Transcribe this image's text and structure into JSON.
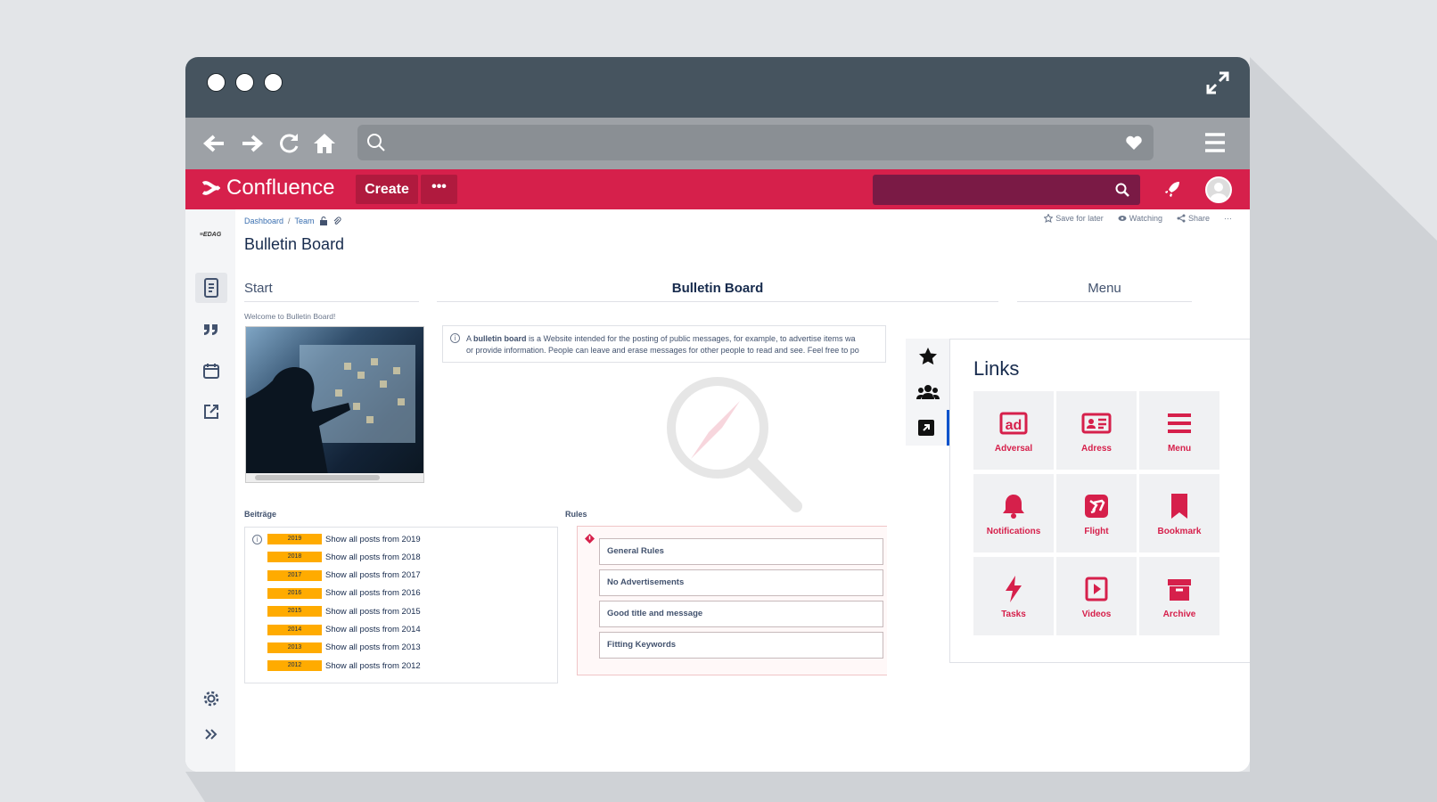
{
  "browser": {
    "nav": [
      "back-icon",
      "forward-icon",
      "reload-icon",
      "home-icon"
    ]
  },
  "confluence": {
    "logo_text": "Confluence",
    "create_label": "Create",
    "more_label": "•••",
    "accent": "#d6204b"
  },
  "sidebar": {
    "logo_text": "≡EDAG"
  },
  "page": {
    "breadcrumb": [
      "Dashboard",
      "Team"
    ],
    "breadcrumb_sep": "/",
    "title": "Bulletin Board",
    "actions": {
      "save": "Save for later",
      "watch": "Watching",
      "share": "Share",
      "more": "···"
    }
  },
  "columns": {
    "start": "Start",
    "center": "Bulletin Board",
    "menu": "Menu"
  },
  "welcome_text": "Welcome to Bulletin Board!",
  "info": {
    "bold": "bulletin board",
    "prefix": "A",
    "line1": " is a Website intended for the posting of public messages, for example, to advertise items wa",
    "line2": "or provide information. People can leave and erase messages for other people to read and see. Feel free to po"
  },
  "beitraege": {
    "label": "Beiträge",
    "posts": [
      {
        "year": "2019",
        "text": "Show all posts from 2019"
      },
      {
        "year": "2018",
        "text": "Show all posts from 2018"
      },
      {
        "year": "2017",
        "text": "Show all posts from 2017"
      },
      {
        "year": "2016",
        "text": "Show all posts from 2016"
      },
      {
        "year": "2015",
        "text": "Show all posts from 2015"
      },
      {
        "year": "2014",
        "text": "Show all posts from 2014"
      },
      {
        "year": "2013",
        "text": "Show all posts from 2013"
      },
      {
        "year": "2012",
        "text": "Show all posts from 2012"
      }
    ]
  },
  "rules": {
    "label": "Rules",
    "items": [
      "General Rules",
      "No Advertisements",
      "Good title and message",
      "Fitting Keywords"
    ]
  },
  "links": {
    "title": "Links",
    "tiles": [
      {
        "label": "Adversal",
        "icon": "ad-icon"
      },
      {
        "label": "Adress",
        "icon": "address-card-icon"
      },
      {
        "label": "Menu",
        "icon": "menu-icon"
      },
      {
        "label": "Notifications",
        "icon": "bell-icon"
      },
      {
        "label": "Flight",
        "icon": "flight-icon"
      },
      {
        "label": "Bookmark",
        "icon": "bookmark-icon"
      },
      {
        "label": "Tasks",
        "icon": "bolt-icon"
      },
      {
        "label": "Videos",
        "icon": "play-icon"
      },
      {
        "label": "Archive",
        "icon": "archive-icon"
      }
    ]
  }
}
